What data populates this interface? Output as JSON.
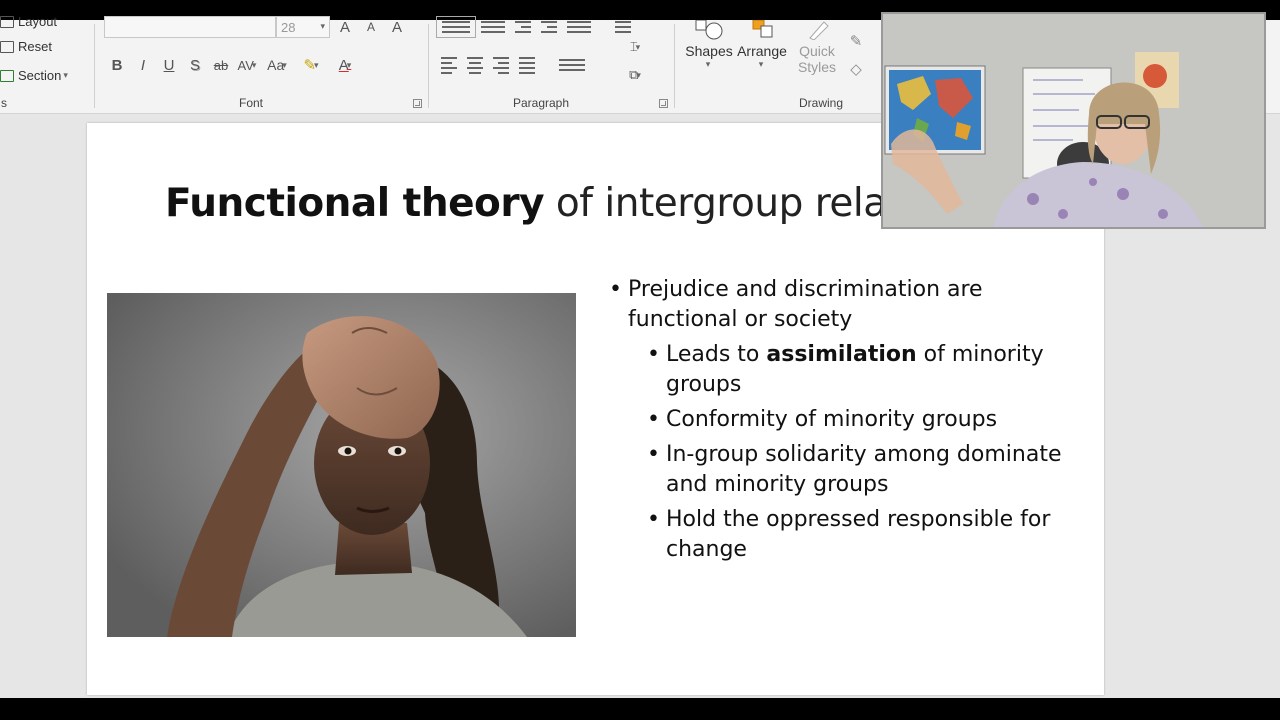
{
  "ribbon": {
    "slides_group": {
      "layout_label": "Layout",
      "reset_label": "Reset",
      "section_label": "Section",
      "group_label_tail": "s"
    },
    "font_group": {
      "font_size": "28",
      "label": "Font",
      "buttons": [
        "B",
        "I",
        "U",
        "S",
        "ab",
        "AV",
        "Aa",
        "A"
      ]
    },
    "paragraph_group": {
      "label": "Paragraph"
    },
    "drawing_group": {
      "label": "Drawing",
      "shapes_label": "Shapes",
      "arrange_label": "Arrange",
      "quick_styles_line1": "Quick",
      "quick_styles_line2": "Styles"
    }
  },
  "slide": {
    "title_bold": "Functional theory",
    "title_rest": " of intergroup relations",
    "bullet_main": "Prejudice and discrimination are functional or society",
    "sub_bullets": [
      {
        "pre": "Leads to ",
        "bold": "assimilation",
        "post": " of minority groups"
      },
      {
        "pre": "Conformity of minority groups",
        "bold": "",
        "post": ""
      },
      {
        "pre": "In-group solidarity among dominate and minority groups",
        "bold": "",
        "post": ""
      },
      {
        "pre": "Hold the oppressed responsible for change",
        "bold": "",
        "post": ""
      }
    ]
  },
  "colors": {
    "app_background": "#e6e6e6",
    "ribbon_background": "#f3f3f3",
    "slide_background": "#ffffff",
    "text": "#111111"
  }
}
